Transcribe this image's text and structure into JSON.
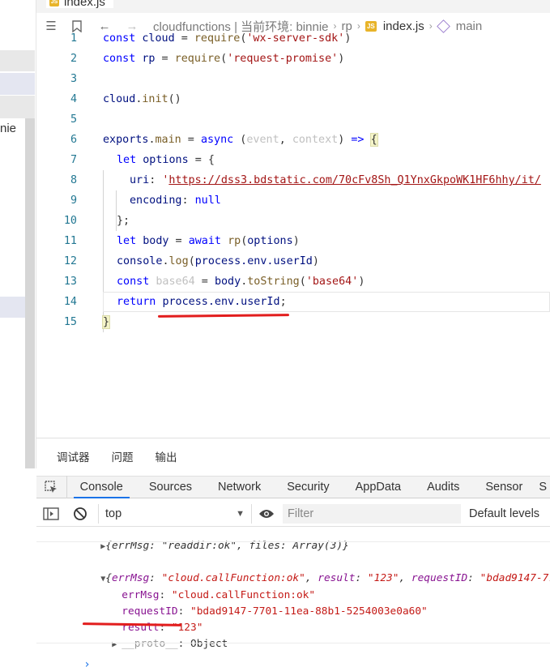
{
  "sidebar": {
    "partial_text": "nie"
  },
  "editor": {
    "tab": {
      "filename": "index.js",
      "badge": "JS"
    },
    "breadcrumb": {
      "path": "cloudfunctions | 当前环境: binnie",
      "folder": "rp",
      "file": "index.js",
      "symbol": "main",
      "file_badge": "JS"
    },
    "lines": [
      {
        "n": "1"
      },
      {
        "n": "2"
      },
      {
        "n": "3"
      },
      {
        "n": "4"
      },
      {
        "n": "5"
      },
      {
        "n": "6"
      },
      {
        "n": "7"
      },
      {
        "n": "8"
      },
      {
        "n": "9"
      },
      {
        "n": "10"
      },
      {
        "n": "11"
      },
      {
        "n": "12"
      },
      {
        "n": "13"
      },
      {
        "n": "14"
      },
      {
        "n": "15"
      }
    ],
    "code": {
      "l1_kw": "const",
      "l1_id": " cloud",
      "l1_eq": " = ",
      "l1_fn": "require",
      "l1_str": "'wx-server-sdk'",
      "l2_kw": "const",
      "l2_id": " rp",
      "l2_eq": " = ",
      "l2_fn": "require",
      "l2_str": "'request-promise'",
      "l4_id": "cloud",
      "l4_fn": "init",
      "l6_id": "exports",
      "l6_fn": "main",
      "l6_kw": "async",
      "l6_p1": "event",
      "l6_p2": "context",
      "l6_arrow": "=>",
      "l7_kw": "let",
      "l7_id": " options",
      "l8_key": "uri",
      "l8_url": "https://dss3.bdstatic.com/70cFv8Sh_Q1YnxGkpoWK1HF6hhy/it/",
      "l9_key": "encoding",
      "l9_val": "null",
      "l11_kw": "let",
      "l11_id": " body",
      "l11_await": "await",
      "l11_fn": "rp",
      "l11_arg": "options",
      "l12_obj": "console",
      "l12_fn": "log",
      "l12_arg": "process.env.userId",
      "l13_kw": "const",
      "l13_id": " base64",
      "l13_obj": "body",
      "l13_fn": "toString",
      "l13_str": "'base64'",
      "l14_kw": "return",
      "l14_expr": "process.env.userId"
    }
  },
  "devtools": {
    "top_tabs": [
      "调试器",
      "问题",
      "输出"
    ],
    "panel_tabs": [
      "Console",
      "Sources",
      "Network",
      "Security",
      "AppData",
      "Audits",
      "Sensor",
      "S"
    ],
    "active_panel": "Console",
    "context": "top",
    "filter_placeholder": "Filter",
    "levels": "Default levels",
    "console": {
      "line1_text": "{errMsg: \"readdir:ok\", files: Array(3)}",
      "obj_summary_key1": "errMsg",
      "obj_summary_val1": "\"cloud.callFunction:ok\"",
      "obj_summary_key2": "result",
      "obj_summary_val2": "\"123\"",
      "obj_summary_key3": "requestID",
      "obj_summary_val3": "\"bdad9147-77",
      "errMsg_key": "errMsg",
      "errMsg_val": "\"cloud.callFunction:ok\"",
      "requestID_key": "requestID",
      "requestID_val": "\"bdad9147-7701-11ea-88b1-5254003e0a60\"",
      "result_key": "result",
      "result_val": "\"123\"",
      "proto_key": "__proto__",
      "proto_val": "Object"
    }
  },
  "colors": {
    "annotation_red": "#e21d1d",
    "accent_blue": "#1a73e8"
  }
}
